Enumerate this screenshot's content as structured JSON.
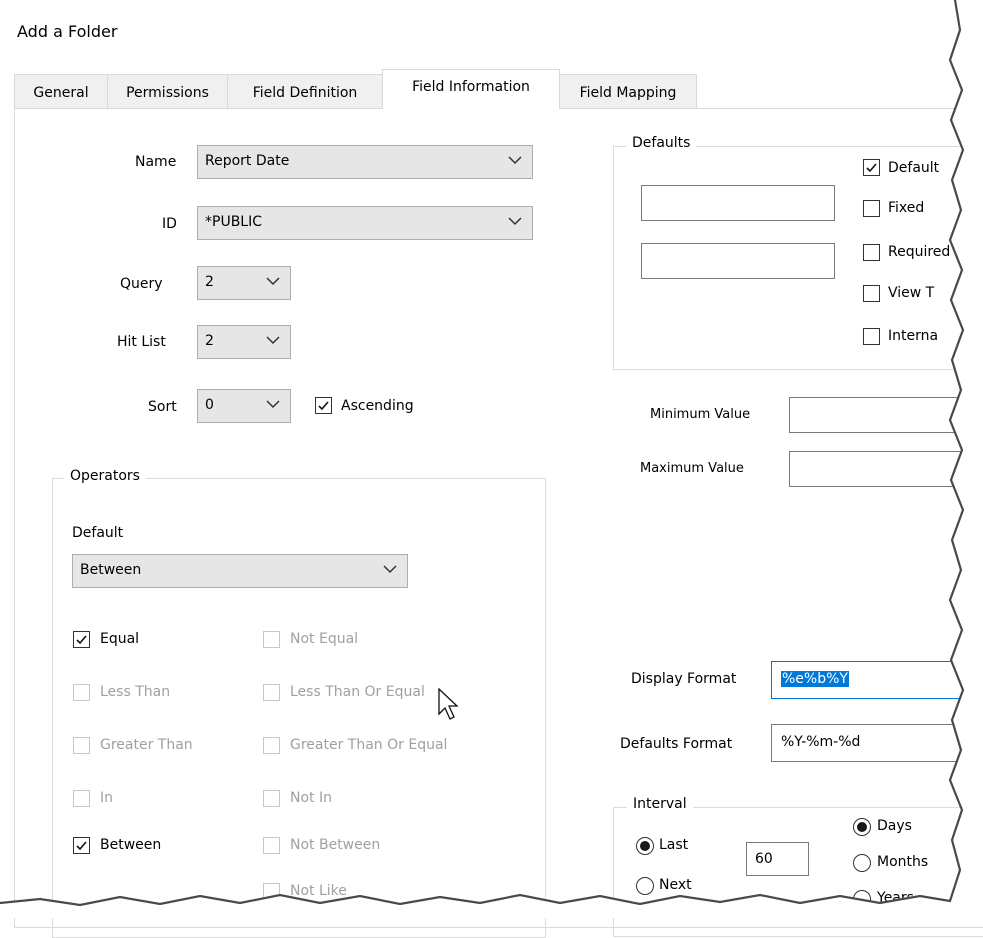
{
  "window": {
    "title": "Add a Folder"
  },
  "tabs": [
    {
      "label": "General",
      "active": false
    },
    {
      "label": "Permissions",
      "active": false
    },
    {
      "label": "Field Definition",
      "active": false
    },
    {
      "label": "Field Information",
      "active": true
    },
    {
      "label": "Field Mapping",
      "active": false
    }
  ],
  "field_info": {
    "name_label": "Name",
    "name_value": "Report Date",
    "id_label": "ID",
    "id_value": "*PUBLIC",
    "query_label": "Query",
    "query_value": "2",
    "hitlist_label": "Hit List",
    "hitlist_value": "2",
    "sort_label": "Sort",
    "sort_value": "0",
    "ascending_label": "Ascending",
    "ascending_checked": true
  },
  "operators": {
    "group_label": "Operators",
    "default_label": "Default",
    "default_value": "Between",
    "items": [
      {
        "label": "Equal",
        "checked": true,
        "enabled": true
      },
      {
        "label": "Not Equal",
        "checked": false,
        "enabled": false
      },
      {
        "label": "Less Than",
        "checked": false,
        "enabled": false
      },
      {
        "label": "Less Than Or Equal",
        "checked": false,
        "enabled": false
      },
      {
        "label": "Greater Than",
        "checked": false,
        "enabled": false
      },
      {
        "label": "Greater Than Or Equal",
        "checked": false,
        "enabled": false
      },
      {
        "label": "In",
        "checked": false,
        "enabled": false
      },
      {
        "label": "Not In",
        "checked": false,
        "enabled": false
      },
      {
        "label": "Between",
        "checked": true,
        "enabled": true
      },
      {
        "label": "Not Between",
        "checked": false,
        "enabled": false
      },
      {
        "label": "Not Like",
        "checked": false,
        "enabled": false
      }
    ]
  },
  "defaults": {
    "group_label": "Defaults",
    "default_value_1": "",
    "default_value_2": "",
    "checks": [
      {
        "label": "Default",
        "checked": true
      },
      {
        "label": "Fixed",
        "checked": false
      },
      {
        "label": "Required",
        "checked": false
      },
      {
        "label": "View T",
        "checked": false
      },
      {
        "label": "Interna",
        "checked": false
      }
    ]
  },
  "range": {
    "min_label": "Minimum Value",
    "min_value": "",
    "max_label": "Maximum Value",
    "max_value": ""
  },
  "format": {
    "display_label": "Display Format",
    "display_value": "%e%b%Y",
    "defaults_label": "Defaults Format",
    "defaults_value": "%Y-%m-%d"
  },
  "interval": {
    "group_label": "Interval",
    "last_label": "Last",
    "next_label": "Next",
    "count_value": "60",
    "days_label": "Days",
    "months_label": "Months",
    "years_label": "Years"
  },
  "colors": {
    "selection": "#0078d7",
    "torn_edge": "#4a4a4a"
  }
}
